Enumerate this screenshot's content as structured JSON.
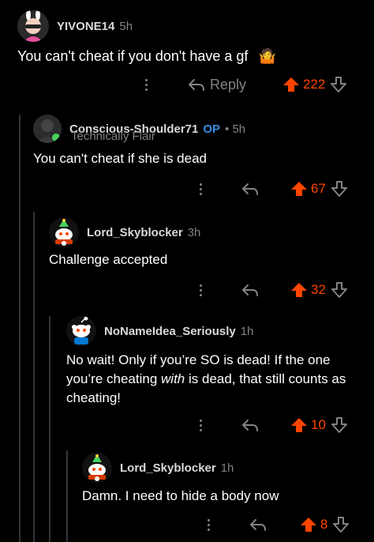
{
  "comments": [
    {
      "username": "YIVONE14",
      "age": "5h",
      "text": "You can't cheat if you don't have a gf",
      "emoji": "🤷",
      "reply_label": "Reply",
      "score": "222"
    },
    {
      "username": "Conscious-Shoulder71",
      "op_badge": "OP",
      "age": "• 5h",
      "flair": "Technically Flair",
      "text": "You can't cheat if she is dead",
      "score": "67"
    },
    {
      "username": "Lord_Skyblocker",
      "age": "3h",
      "text": "Challenge accepted",
      "score": "32"
    },
    {
      "username": "NoNameIdea_Seriously",
      "age": "1h",
      "text_before": "No wait! Only if you’re SO is dead! If the one you’re cheating ",
      "text_em": "with",
      "text_after": " is dead, that still counts as cheating!",
      "score": "10"
    },
    {
      "username": "Lord_Skyblocker",
      "age": "1h",
      "text": "Damn. I need to hide a body now",
      "score": "8"
    }
  ],
  "colors": {
    "background": "#000000",
    "upvote": "#ff4500",
    "op_badge": "#3a8ee6",
    "muted": "#818384"
  }
}
